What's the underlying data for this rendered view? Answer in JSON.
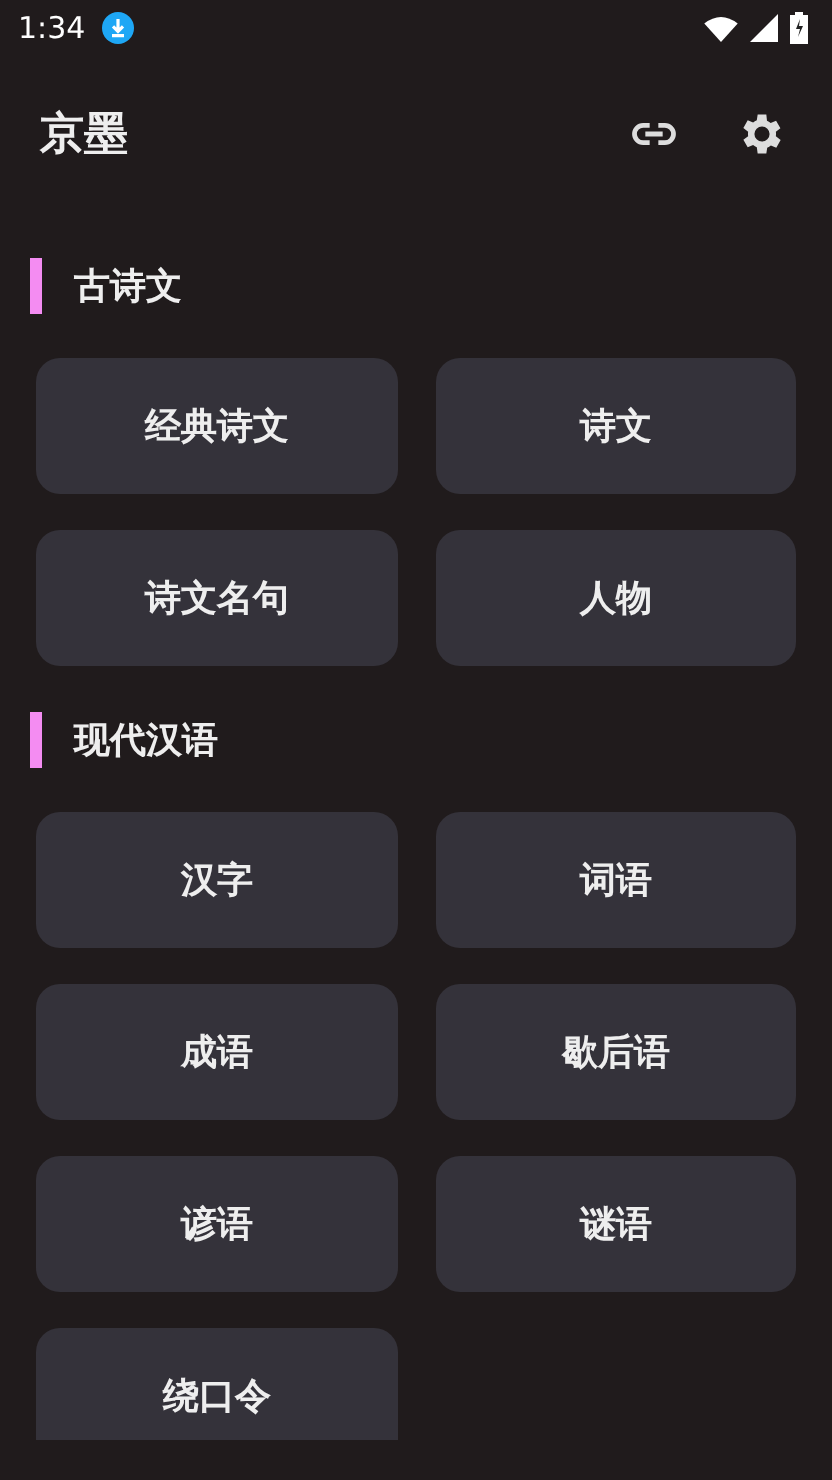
{
  "status_bar": {
    "time": "1:34"
  },
  "app_bar": {
    "title": "京墨"
  },
  "sections": [
    {
      "title": "古诗文",
      "items": [
        "经典诗文",
        "诗文",
        "诗文名句",
        "人物"
      ]
    },
    {
      "title": "现代汉语",
      "items": [
        "汉字",
        "词语",
        "成语",
        "歇后语",
        "谚语",
        "谜语",
        "绕口令"
      ]
    }
  ]
}
